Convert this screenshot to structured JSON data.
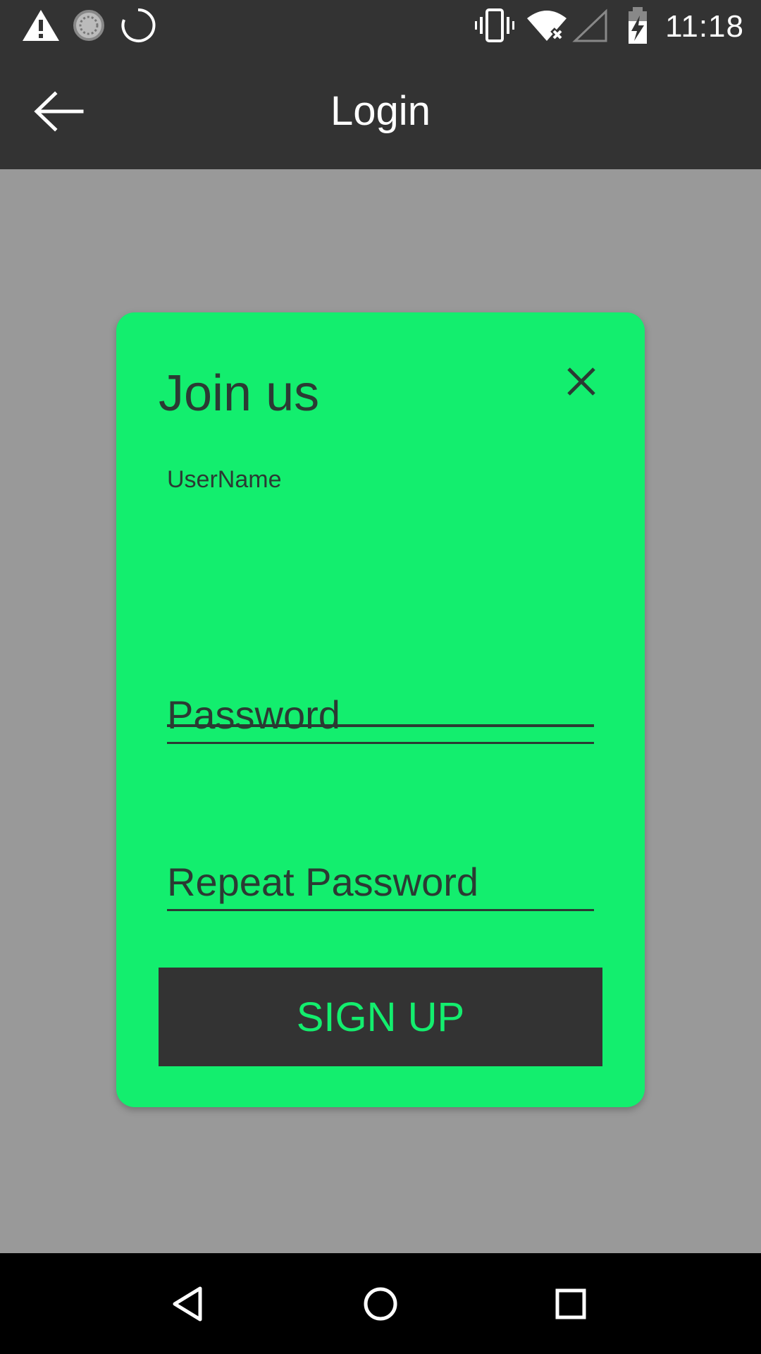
{
  "status_bar": {
    "time": "11:18",
    "icons": [
      "warning-icon",
      "sync-icon",
      "loading-spinner-icon",
      "vibrate-icon",
      "wifi-off-icon",
      "signal-empty-icon",
      "battery-charging-icon"
    ]
  },
  "app_bar": {
    "title": "Login",
    "back_icon": "arrow-left-icon"
  },
  "dialog": {
    "title": "Join us",
    "close_icon": "close-icon",
    "username": {
      "label": "UserName",
      "value": ""
    },
    "password": {
      "placeholder": "Password",
      "value": ""
    },
    "repeat_password": {
      "placeholder": "Repeat Password",
      "value": ""
    },
    "signup_label": "SIGN UP"
  },
  "nav_bar": {
    "icons": [
      "back-triangle-icon",
      "home-circle-icon",
      "recents-square-icon"
    ]
  },
  "colors": {
    "accent_green": "#13ee6e",
    "dark_bar": "#333333",
    "scrim": "#999999",
    "dark_text": "#2b3a33"
  }
}
